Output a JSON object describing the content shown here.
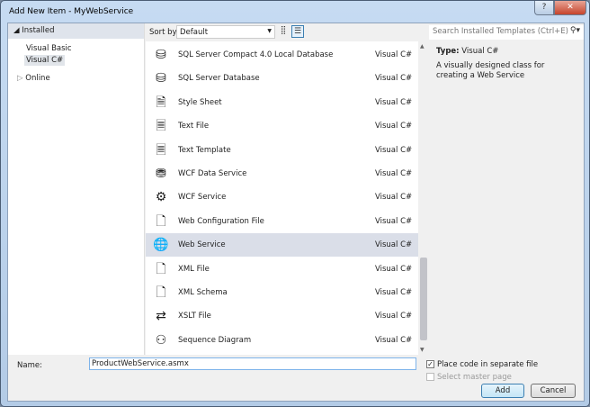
{
  "window": {
    "title": "Add New Item - MyWebService",
    "help": "?",
    "close": "✕"
  },
  "left": {
    "installed": "Installed",
    "nodes": [
      "Visual Basic",
      "Visual C#"
    ],
    "online": "Online"
  },
  "toolbar": {
    "sort_label": "Sort by:",
    "sort_value": "Default"
  },
  "search": {
    "placeholder": "Search Installed Templates (Ctrl+E)"
  },
  "templates": [
    {
      "name": "SQL Server Compact 4.0 Local Database",
      "lang": "Visual C#",
      "icon": "database-icon"
    },
    {
      "name": "SQL Server Database",
      "lang": "Visual C#",
      "icon": "database-icon"
    },
    {
      "name": "Style Sheet",
      "lang": "Visual C#",
      "icon": "stylesheet-icon"
    },
    {
      "name": "Text File",
      "lang": "Visual C#",
      "icon": "text-file-icon"
    },
    {
      "name": "Text Template",
      "lang": "Visual C#",
      "icon": "text-template-icon"
    },
    {
      "name": "WCF Data Service",
      "lang": "Visual C#",
      "icon": "wcf-data-service-icon"
    },
    {
      "name": "WCF Service",
      "lang": "Visual C#",
      "icon": "wcf-service-icon"
    },
    {
      "name": "Web Configuration File",
      "lang": "Visual C#",
      "icon": "web-config-icon"
    },
    {
      "name": "Web Service",
      "lang": "Visual C#",
      "icon": "web-service-icon"
    },
    {
      "name": "XML File",
      "lang": "Visual C#",
      "icon": "xml-file-icon"
    },
    {
      "name": "XML Schema",
      "lang": "Visual C#",
      "icon": "xml-schema-icon"
    },
    {
      "name": "XSLT File",
      "lang": "Visual C#",
      "icon": "xslt-file-icon"
    },
    {
      "name": "Sequence Diagram",
      "lang": "Visual C#",
      "icon": "sequence-diagram-icon"
    }
  ],
  "details": {
    "type_label": "Type:",
    "type_value": "Visual C#",
    "description": "A visually designed class for creating a Web Service"
  },
  "bottom": {
    "name_label": "Name:",
    "name_value": "ProductWebService.asmx",
    "place_code": "Place code in separate file",
    "master_page": "Select master page",
    "add": "Add",
    "cancel": "Cancel"
  }
}
